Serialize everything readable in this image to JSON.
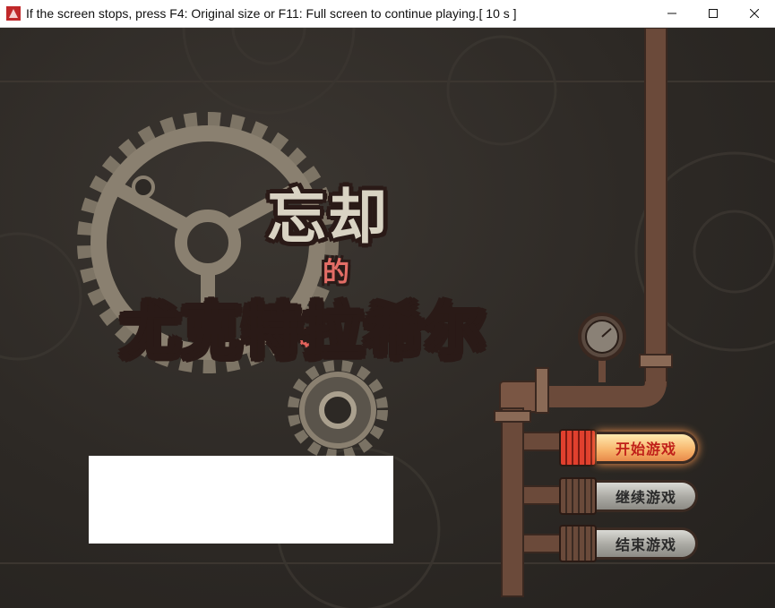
{
  "window": {
    "title": "If the screen stops, press F4: Original size or F11: Full screen to continue playing.[ 10 s ]",
    "minimize_icon": "minimize-icon",
    "maximize_icon": "maximize-icon",
    "close_icon": "close-icon"
  },
  "game": {
    "title_line1": "忘却",
    "title_line2": "的",
    "title_line3": "尤克特拉希尔"
  },
  "menu": {
    "start_label": "开始游戏",
    "continue_label": "继续游戏",
    "exit_label": "结束游戏"
  },
  "colors": {
    "background": "#2d2925",
    "gear": "#8a8070",
    "pipe": "#6b4a3a",
    "title_pink": "#ef8880",
    "title_cream": "#d9d3c3",
    "start_glow": "#f7b36a"
  }
}
